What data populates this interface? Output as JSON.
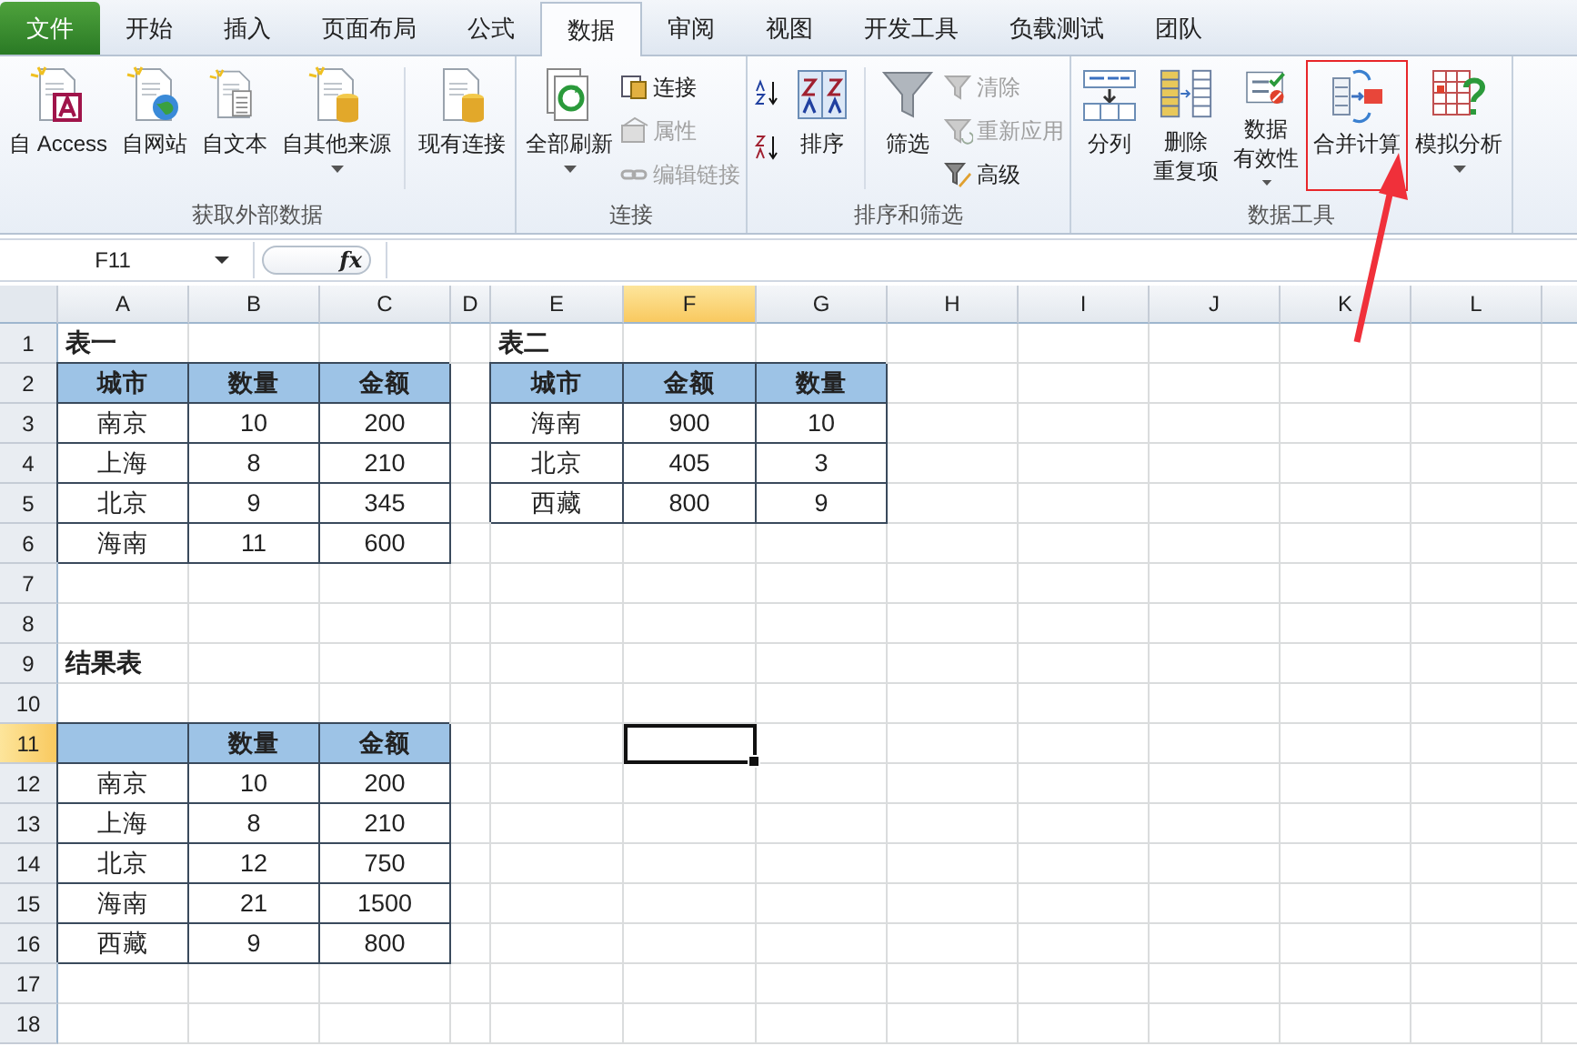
{
  "ribbon_tabs": [
    {
      "label": "文件",
      "kind": "file",
      "selected": false
    },
    {
      "label": "开始",
      "kind": "tab",
      "selected": false
    },
    {
      "label": "插入",
      "kind": "tab",
      "selected": false
    },
    {
      "label": "页面布局",
      "kind": "tab",
      "selected": false
    },
    {
      "label": "公式",
      "kind": "tab",
      "selected": false
    },
    {
      "label": "数据",
      "kind": "tab",
      "selected": true
    },
    {
      "label": "审阅",
      "kind": "tab",
      "selected": false
    },
    {
      "label": "视图",
      "kind": "tab",
      "selected": false
    },
    {
      "label": "开发工具",
      "kind": "tab",
      "selected": false
    },
    {
      "label": "负载测试",
      "kind": "tab",
      "selected": false
    },
    {
      "label": "团队",
      "kind": "tab",
      "selected": false
    }
  ],
  "ribbon_groups": [
    {
      "label": "获取外部数据",
      "items": [
        {
          "kind": "large",
          "lines": [
            "自 Access"
          ],
          "disabled": false,
          "dropdown": false,
          "highlighted": false
        },
        {
          "kind": "large",
          "lines": [
            "自网站"
          ],
          "disabled": false,
          "dropdown": false,
          "highlighted": false
        },
        {
          "kind": "large",
          "lines": [
            "自文本"
          ],
          "disabled": false,
          "dropdown": false,
          "highlighted": false
        },
        {
          "kind": "large",
          "lines": [
            "自其他来源"
          ],
          "disabled": false,
          "dropdown": true,
          "highlighted": false
        },
        {
          "kind": "separator"
        },
        {
          "kind": "large",
          "lines": [
            "现有连接"
          ],
          "disabled": false,
          "dropdown": false,
          "highlighted": false
        }
      ]
    },
    {
      "label": "连接",
      "items": [
        {
          "kind": "large",
          "lines": [
            "全部刷新"
          ],
          "disabled": false,
          "dropdown": true,
          "highlighted": false
        },
        {
          "kind": "stack",
          "buttons": [
            {
              "label": "连接",
              "disabled": false
            },
            {
              "label": "属性",
              "disabled": true
            },
            {
              "label": "编辑链接",
              "disabled": true
            }
          ]
        }
      ]
    },
    {
      "label": "排序和筛选",
      "items": [
        {
          "kind": "sort_icons"
        },
        {
          "kind": "large",
          "lines": [
            "排序"
          ],
          "disabled": false,
          "dropdown": false,
          "highlighted": false
        },
        {
          "kind": "separator"
        },
        {
          "kind": "large",
          "lines": [
            "筛选"
          ],
          "disabled": false,
          "dropdown": false,
          "highlighted": false
        },
        {
          "kind": "stack",
          "buttons": [
            {
              "label": "清除",
              "disabled": true
            },
            {
              "label": "重新应用",
              "disabled": true
            },
            {
              "label": "高级",
              "disabled": false
            }
          ]
        }
      ]
    },
    {
      "label": "数据工具",
      "items": [
        {
          "kind": "large",
          "lines": [
            "分列"
          ],
          "disabled": false,
          "dropdown": false,
          "highlighted": false
        },
        {
          "kind": "large",
          "lines": [
            "删除",
            "重复项"
          ],
          "disabled": false,
          "dropdown": false,
          "highlighted": false
        },
        {
          "kind": "large",
          "lines": [
            "数据",
            "有效性"
          ],
          "disabled": false,
          "dropdown": true,
          "highlighted": false
        },
        {
          "kind": "large",
          "lines": [
            "合并计算"
          ],
          "disabled": false,
          "dropdown": false,
          "highlighted": true
        },
        {
          "kind": "large",
          "lines": [
            "模拟分析"
          ],
          "disabled": false,
          "dropdown": true,
          "highlighted": false
        }
      ]
    }
  ],
  "formula_bar": {
    "name_box": "F11",
    "fx": "fx"
  },
  "sheet": {
    "columns": [
      {
        "label": "A",
        "selected": false
      },
      {
        "label": "B",
        "selected": false
      },
      {
        "label": "C",
        "selected": false
      },
      {
        "label": "D",
        "selected": false
      },
      {
        "label": "E",
        "selected": false
      },
      {
        "label": "F",
        "selected": true
      },
      {
        "label": "G",
        "selected": false
      },
      {
        "label": "H",
        "selected": false
      },
      {
        "label": "I",
        "selected": false
      },
      {
        "label": "J",
        "selected": false
      },
      {
        "label": "K",
        "selected": false
      },
      {
        "label": "L",
        "selected": false
      }
    ],
    "rows": [
      {
        "label": "1",
        "selected": false
      },
      {
        "label": "2",
        "selected": false
      },
      {
        "label": "3",
        "selected": false
      },
      {
        "label": "4",
        "selected": false
      },
      {
        "label": "5",
        "selected": false
      },
      {
        "label": "6",
        "selected": false
      },
      {
        "label": "7",
        "selected": false
      },
      {
        "label": "8",
        "selected": false
      },
      {
        "label": "9",
        "selected": false
      },
      {
        "label": "10",
        "selected": false
      },
      {
        "label": "11",
        "selected": true
      },
      {
        "label": "12",
        "selected": false
      },
      {
        "label": "13",
        "selected": false
      },
      {
        "label": "14",
        "selected": false
      },
      {
        "label": "15",
        "selected": false
      },
      {
        "label": "16",
        "selected": false
      },
      {
        "label": "17",
        "selected": false
      },
      {
        "label": "18",
        "selected": false
      }
    ],
    "tables": [
      {
        "title": "表一",
        "blank_corner": false,
        "header": [
          "城市",
          "数量",
          "金额"
        ],
        "rows": [
          [
            "南京",
            "10",
            "200"
          ],
          [
            "上海",
            "8",
            "210"
          ],
          [
            "北京",
            "9",
            "345"
          ],
          [
            "海南",
            "11",
            "600"
          ]
        ]
      },
      {
        "title": "表二",
        "blank_corner": false,
        "header": [
          "城市",
          "金额",
          "数量"
        ],
        "rows": [
          [
            "海南",
            "900",
            "10"
          ],
          [
            "北京",
            "405",
            "3"
          ],
          [
            "西藏",
            "800",
            "9"
          ]
        ]
      },
      {
        "title": "结果表",
        "blank_corner": true,
        "header": [
          "数量",
          "金额"
        ],
        "rows": [
          [
            "南京",
            "10",
            "200"
          ],
          [
            "上海",
            "8",
            "210"
          ],
          [
            "北京",
            "12",
            "750"
          ],
          [
            "海南",
            "21",
            "1500"
          ],
          [
            "西藏",
            "9",
            "800"
          ]
        ]
      }
    ]
  }
}
